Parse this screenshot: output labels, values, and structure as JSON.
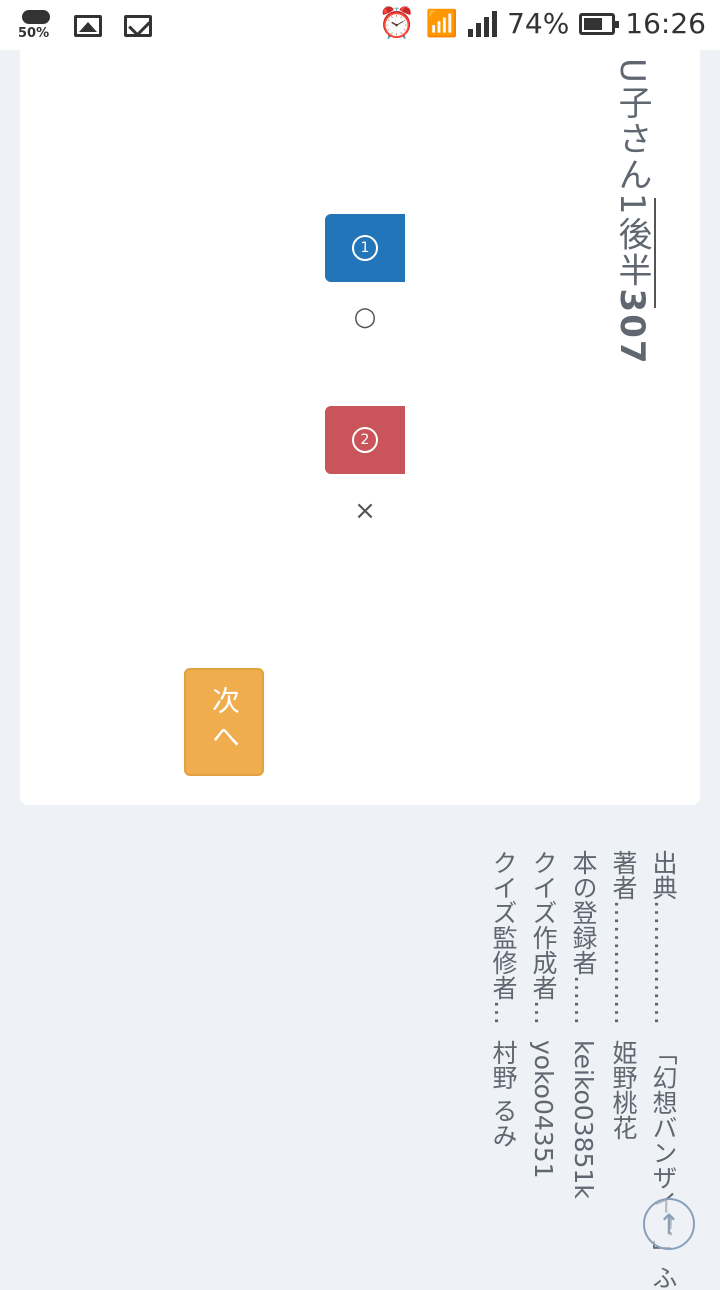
{
  "status_bar": {
    "weather_percent": "50%",
    "battery": "74%",
    "time": "16:26"
  },
  "quiz": {
    "title_vertical": "U子さん1後半",
    "number": "307",
    "options": [
      {
        "label": "①",
        "answer": "○"
      },
      {
        "label": "②",
        "answer": "×"
      }
    ],
    "next_label": "次へ"
  },
  "credits": [
    {
      "label": "出典……………",
      "value": "「幻想バンザイ！」ふ"
    },
    {
      "label": "著者……………",
      "value": "姫野桃花"
    },
    {
      "label": "本の登録者……",
      "value": "keiko03851k"
    },
    {
      "label": "クイズ作成者…",
      "value": "yoko04351"
    },
    {
      "label": "クイズ監修者…",
      "value": "村野 るみ"
    }
  ],
  "colors": {
    "option1": "#2275b8",
    "option2": "#c95459",
    "next": "#f0ad4e"
  },
  "icons": {
    "scroll_top": "arrow-up-circle-icon"
  }
}
